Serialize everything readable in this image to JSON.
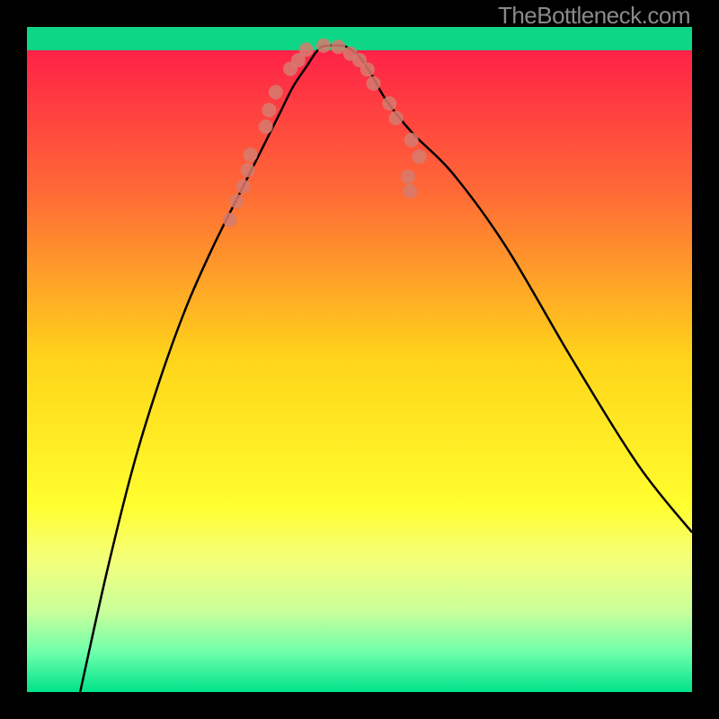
{
  "watermark": "TheBottleneck.com",
  "chart_data": {
    "type": "line",
    "title": "",
    "xlabel": "",
    "ylabel": "",
    "xlim": [
      0,
      100
    ],
    "ylim": [
      0,
      100
    ],
    "grid": false,
    "legend": false,
    "background_gradient": {
      "stops": [
        {
          "offset": 0.0,
          "color": "#ff164a"
        },
        {
          "offset": 0.25,
          "color": "#ff6a36"
        },
        {
          "offset": 0.5,
          "color": "#ffd51a"
        },
        {
          "offset": 0.72,
          "color": "#fffe2e"
        },
        {
          "offset": 0.8,
          "color": "#f4ff7a"
        },
        {
          "offset": 0.88,
          "color": "#c8ff9a"
        },
        {
          "offset": 0.94,
          "color": "#6fffab"
        },
        {
          "offset": 1.0,
          "color": "#00e28a"
        }
      ]
    },
    "green_band": {
      "y_top": 96.5,
      "y_bottom": 100
    },
    "curve": {
      "description": "Bottleneck curve: V-shape with minimum near x~44 at y~97, rising steeply to left (y~0 at x~8) and moderately to right (y~70 at x~100).",
      "x": [
        8,
        12,
        16,
        20,
        24,
        28,
        32,
        34,
        36,
        38,
        40,
        42,
        44,
        46,
        48,
        50,
        52,
        54,
        58,
        64,
        72,
        82,
        92,
        100
      ],
      "y": [
        0,
        18,
        34,
        47,
        58,
        67,
        75,
        79,
        83,
        87,
        91,
        94,
        96.8,
        97.2,
        97.0,
        95.5,
        92.5,
        89,
        84,
        78,
        67,
        50,
        34,
        24
      ]
    },
    "dots": {
      "description": "salmon data point markers near the curve trough",
      "points": [
        {
          "x": 30.5,
          "y": 71
        },
        {
          "x": 31.5,
          "y": 73.8
        },
        {
          "x": 32.5,
          "y": 76
        },
        {
          "x": 33.2,
          "y": 78.5
        },
        {
          "x": 33.6,
          "y": 80.8
        },
        {
          "x": 35.9,
          "y": 85
        },
        {
          "x": 36.4,
          "y": 87.5
        },
        {
          "x": 37.4,
          "y": 90.2
        },
        {
          "x": 39.6,
          "y": 93.7
        },
        {
          "x": 40.8,
          "y": 95
        },
        {
          "x": 42.0,
          "y": 96.6
        },
        {
          "x": 44.6,
          "y": 97.2
        },
        {
          "x": 46.8,
          "y": 97.0
        },
        {
          "x": 48.6,
          "y": 96.0
        },
        {
          "x": 50.0,
          "y": 95.0
        },
        {
          "x": 51.2,
          "y": 93.6
        },
        {
          "x": 52.1,
          "y": 91.5
        },
        {
          "x": 54.5,
          "y": 88.5
        },
        {
          "x": 55.5,
          "y": 86.3
        },
        {
          "x": 57.8,
          "y": 83
        },
        {
          "x": 59.0,
          "y": 80.5
        },
        {
          "x": 57.3,
          "y": 77.5
        },
        {
          "x": 57.6,
          "y": 75.3
        }
      ],
      "radius": 8,
      "color": "#d67b6f"
    }
  }
}
